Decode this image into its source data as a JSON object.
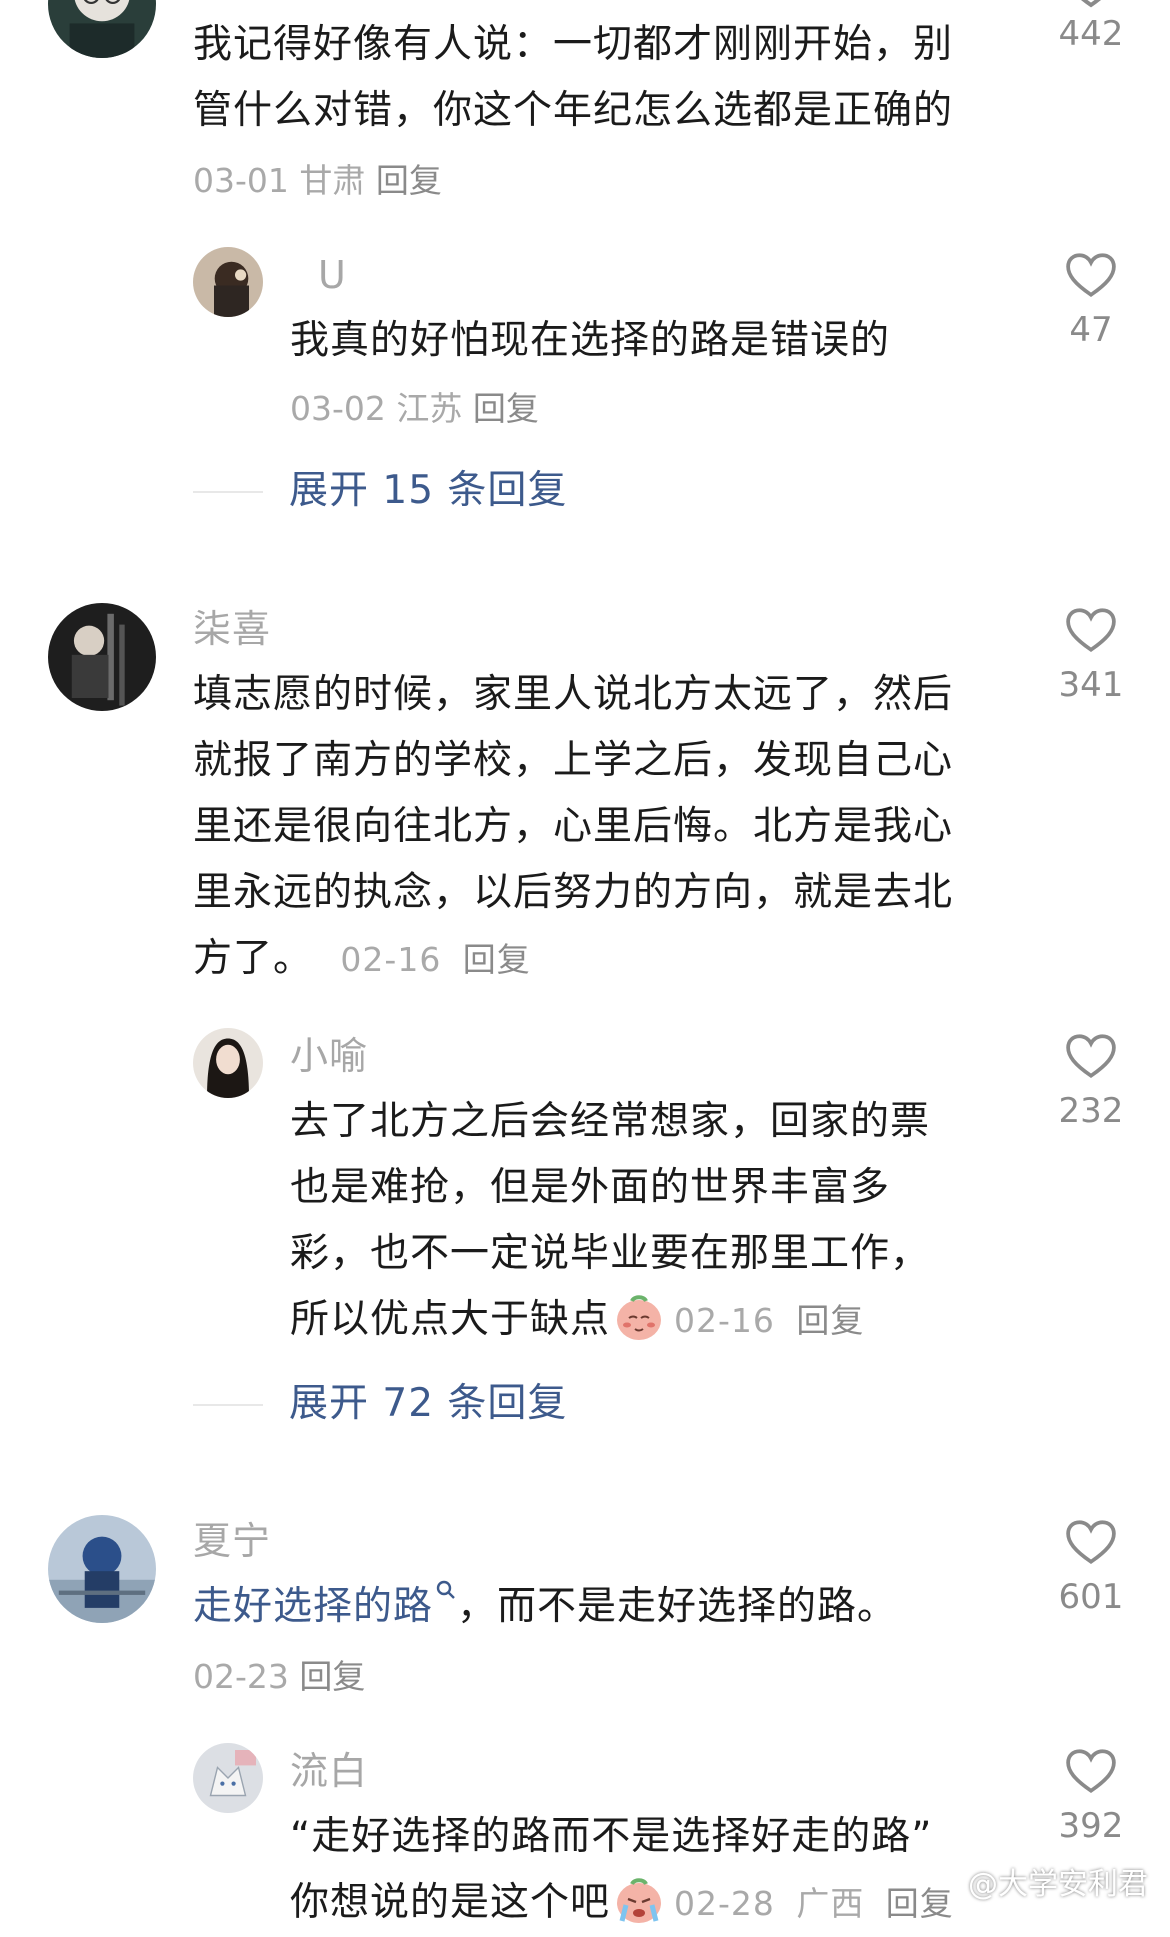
{
  "comments": [
    {
      "text_lines": [
        "我记得好像有人说：一切都才刚刚开始，别",
        "管什么对错，你这个年纪怎么选都是正确的"
      ],
      "date": "03-01",
      "location": "甘肃",
      "reply_label": "回复",
      "likes": "442",
      "reply": {
        "username": "U",
        "text_lines": [
          "我真的好怕现在选择的路是错误的"
        ],
        "date": "03-02",
        "location": "江苏",
        "reply_label": "回复",
        "likes": "47"
      },
      "expand_label": "展开 15 条回复"
    },
    {
      "username": "柒喜",
      "text_lines": [
        "填志愿的时候，家里人说北方太远了，然后",
        "就报了南方的学校，上学之后，发现自己心",
        "里还是很向往北方，心里后悔。北方是我心",
        "里永远的执念，以后努力的方向，就是去北",
        "方了。"
      ],
      "date": "02-16",
      "reply_label": "回复",
      "likes": "341",
      "reply": {
        "username": "小喻",
        "text_lines": [
          "去了北方之后会经常想家，回家的票",
          "也是难抢，但是外面的世界丰富多",
          "彩，也不一定说毕业要在那里工作，",
          "所以优点大于缺点"
        ],
        "emoji": "shy-face-emoji",
        "date": "02-16",
        "reply_label": "回复",
        "likes": "232"
      },
      "expand_label": "展开 72 条回复"
    },
    {
      "username": "夏宁",
      "link_text": "走好选择的路",
      "text_rest": "，而不是走好选择的路。",
      "date": "02-23",
      "reply_label": "回复",
      "likes": "601",
      "reply": {
        "username": "流白",
        "text_lines": [
          "“走好选择的路而不是选择好走的路”",
          "你想说的是这个吧"
        ],
        "emoji": "crying-face-emoji",
        "date": "02-28",
        "location": "广西",
        "reply_label": "回复",
        "likes": "392"
      }
    }
  ],
  "watermark": "@大学安利君",
  "colors": {
    "text": "#1b1b1b",
    "muted": "#a9a9a9",
    "link": "#3d5a8c",
    "icon": "#8a8a8a"
  }
}
